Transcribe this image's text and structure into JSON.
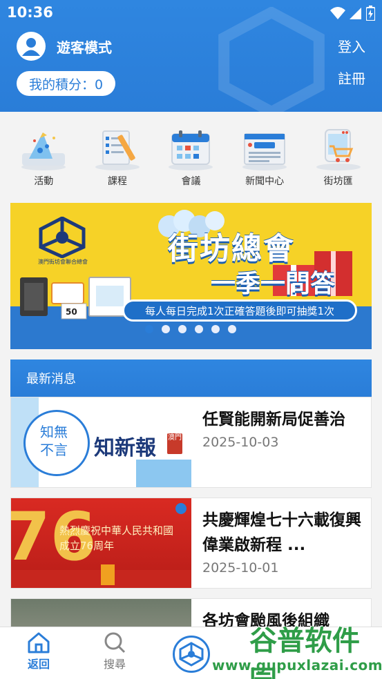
{
  "status_bar": {
    "time": "10:36"
  },
  "header": {
    "guest_label": "遊客模式",
    "points_label": "我的積分：0",
    "login_label": "登入",
    "register_label": "註冊"
  },
  "categories": [
    {
      "label": "活動",
      "icon": "party-hat-icon"
    },
    {
      "label": "課程",
      "icon": "checklist-icon"
    },
    {
      "label": "會議",
      "icon": "calendar-icon"
    },
    {
      "label": "新聞中心",
      "icon": "newspaper-icon"
    },
    {
      "label": "街坊匯",
      "icon": "shopping-cart-icon"
    }
  ],
  "banner": {
    "title_line1": "街坊總會",
    "title_line2": "一季一問答",
    "caption": "每人每日完成1次正確答題後即可抽獎1次",
    "org_name": "澳門街坊會聯合總會",
    "prize_label": "50",
    "dots_count": 6,
    "active_dot": 0
  },
  "news": {
    "section_title": "最新消息",
    "items": [
      {
        "title": "任賢能開新局促善治",
        "date": "2025-10-03",
        "thumb_text_1": "知無",
        "thumb_text_2": "不言",
        "thumb_text_3": "知新報",
        "thumb_badge": "澳門"
      },
      {
        "title": "共慶輝煌七十六載復興偉業啟新程 ...",
        "date": "2025-10-01",
        "thumb_text_1": "熱烈慶祝中華人民共和國",
        "thumb_text_2": "成立76周年",
        "thumb_big": "76"
      },
      {
        "title": "各坊會颱風後組織"
      }
    ]
  },
  "bottom_nav": {
    "back_label": "返回",
    "search_label": "搜尋"
  },
  "watermark": {
    "brand": "谷普软件园",
    "url": "www.gupuxlazai.com"
  },
  "colors": {
    "primary": "#2a7dd8",
    "banner_yellow": "#f6d227",
    "watermark_green": "#2f9d48"
  }
}
